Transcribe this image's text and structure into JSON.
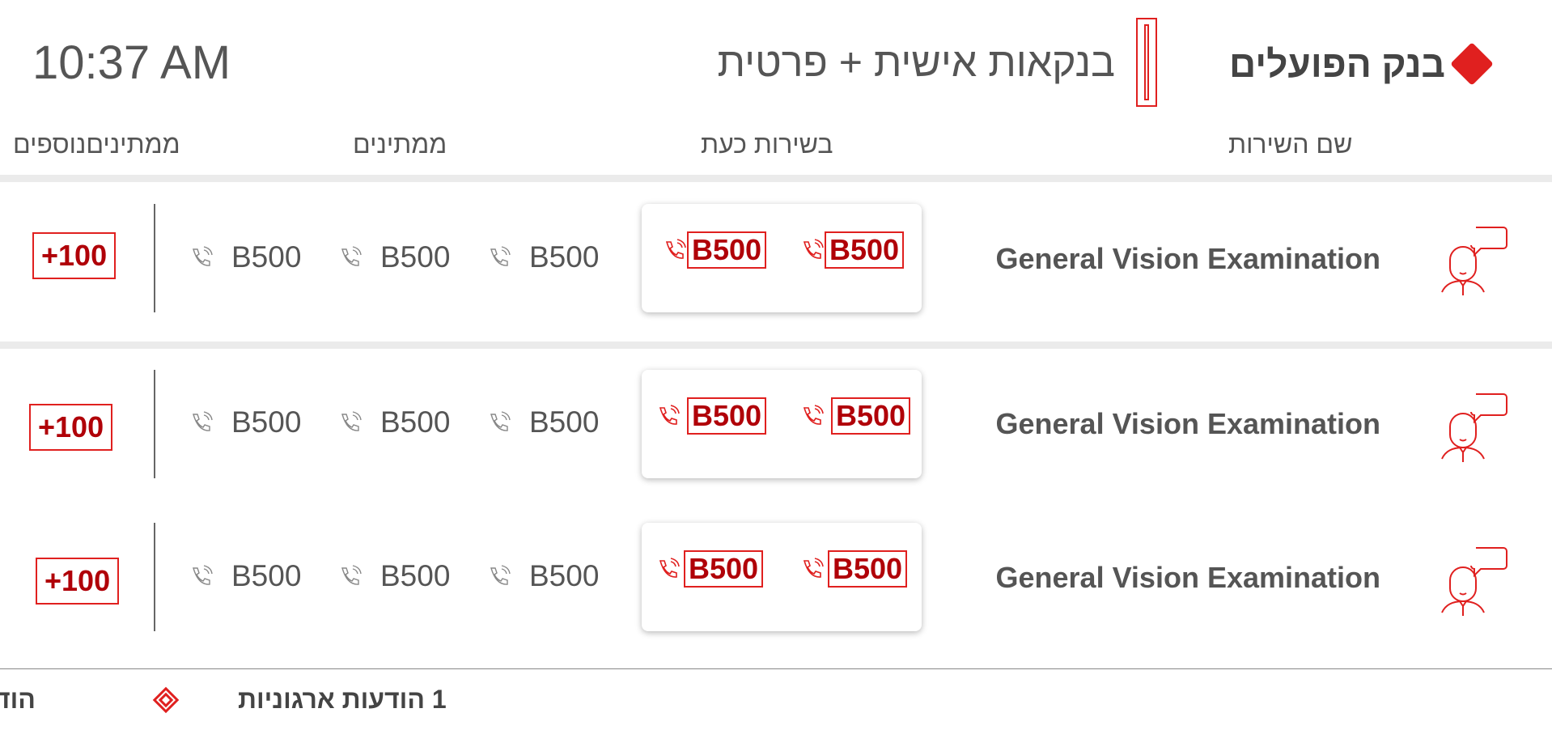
{
  "header": {
    "time": "10:37 AM",
    "branch_title": "בנקאות אישית + פרטית",
    "brand_name": "בנק הפועלים"
  },
  "columns": {
    "service_name": "שם השירות",
    "now_serving": "בשירות כעת",
    "waiting": "ממתינים",
    "more_waiting": "ממתיניםנוספים"
  },
  "rows": [
    {
      "service": "General Vision Examination",
      "now": [
        "B500",
        "B500"
      ],
      "waiting": [
        "B500",
        "B500",
        "B500"
      ],
      "more": "+100"
    },
    {
      "service": "General Vision Examination",
      "now": [
        "B500",
        "B500"
      ],
      "waiting": [
        "B500",
        "B500",
        "B500"
      ],
      "more": "+100"
    },
    {
      "service": "General Vision Examination",
      "now": [
        "B500",
        "B500"
      ],
      "waiting": [
        "B500",
        "B500",
        "B500"
      ],
      "more": "+100"
    }
  ],
  "footer": {
    "ticker_main": "1 הודעות ארגוניות",
    "ticker_partial": "הוד"
  },
  "colors": {
    "accent": "#e0201f",
    "accent_dark": "#b00008",
    "text": "#555555"
  },
  "icons": {
    "service": "customer-service-icon",
    "phone": "phone-ringing-icon",
    "brand": "diamond-logo-icon",
    "ticker": "diamond-outline-icon"
  }
}
